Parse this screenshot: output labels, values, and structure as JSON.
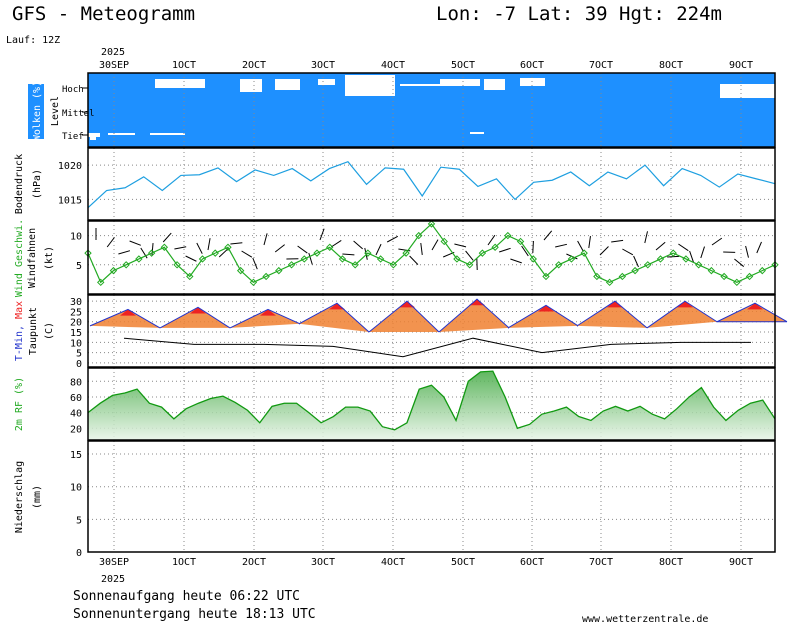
{
  "header": {
    "title": "GFS - Meteogramm",
    "location": "Lon: -7 Lat: 39 Hgt: 224m",
    "run": "Lauf: 12Z",
    "year_top": "2025",
    "year_bottom": "2025"
  },
  "footer": {
    "sunrise": "Sonnenaufgang heute 06:22 UTC",
    "sunset": "Sonnenuntergang heute 18:13 UTC",
    "source": "www.wetterzentrale.de"
  },
  "colors": {
    "cloud_blue": "#1e90ff",
    "pressure": "#1e9fe0",
    "wind": "#22aa22",
    "tmin": "#2233cc",
    "tmax": "#ee2222",
    "dewpoint": "#000000",
    "rh_fill": "#44aa44",
    "rh_line": "#119911",
    "grid": "#888888"
  },
  "chart_data": [
    {
      "type": "area",
      "panel": "clouds",
      "ylabel": "Wolken (%)",
      "ylabel2": "Level",
      "categories": [
        "30SEP",
        "1OCT",
        "2OCT",
        "3OCT",
        "4OCT",
        "5OCT",
        "6OCT",
        "7OCT",
        "8OCT",
        "9OCT"
      ],
      "levels": [
        "Hoch",
        "Mittel",
        "Tief"
      ],
      "series": [
        {
          "name": "Hoch",
          "values": [
            100,
            65,
            55,
            60,
            30,
            95,
            60,
            100,
            100,
            80
          ]
        },
        {
          "name": "Mittel",
          "values": [
            100,
            100,
            100,
            100,
            80,
            100,
            100,
            100,
            100,
            100
          ]
        },
        {
          "name": "Tief",
          "values": [
            90,
            100,
            100,
            100,
            100,
            100,
            100,
            100,
            100,
            100
          ]
        }
      ]
    },
    {
      "type": "line",
      "panel": "pressure",
      "ylabel": "Bodendruck",
      "unit": "(hPa)",
      "yticks": [
        1015,
        1020
      ],
      "ylim": [
        1012,
        1022.5
      ],
      "series": [
        {
          "values": [
            1013.8,
            1016.3,
            1016.7,
            1018.3,
            1016.3,
            1018.5,
            1018.6,
            1019.6,
            1017.6,
            1019.3,
            1018.5,
            1019.5,
            1017.7,
            1019.5,
            1020.5,
            1017.2,
            1019.6,
            1019.4,
            1015.5,
            1019.7,
            1019.4,
            1016.9,
            1018.0,
            1015.0,
            1017.5,
            1017.8,
            1019.0,
            1017.0,
            1019.0,
            1018.0,
            1020.0,
            1017.0,
            1019.5,
            1018.5,
            1016.8,
            1018.7,
            1018.0,
            1017.3
          ]
        }
      ]
    },
    {
      "type": "line",
      "panel": "wind",
      "ylabel": "Wind Geschwi.",
      "ylabel2": "Windfahnen",
      "unit": "(kt)",
      "yticks": [
        5,
        10
      ],
      "ylim": [
        0,
        12.5
      ],
      "series": [
        {
          "name": "Wind Geschwi.",
          "values": [
            7,
            2,
            4,
            5,
            6,
            7,
            8,
            5,
            3,
            6,
            7,
            8,
            4,
            2,
            3,
            4,
            5,
            6,
            7,
            8,
            6,
            5,
            7,
            6,
            5,
            7,
            10,
            12,
            9,
            6,
            5,
            7,
            8,
            10,
            9,
            6,
            3,
            5,
            6,
            7,
            3,
            2,
            3,
            4,
            5,
            6,
            7,
            6,
            5,
            4,
            3,
            2,
            3,
            4,
            5
          ]
        }
      ]
    },
    {
      "type": "area",
      "panel": "temperature",
      "ylabel": "T-Min, Max",
      "ylabel2": "Taupunkt",
      "unit": "(C)",
      "yticks": [
        0,
        5,
        10,
        15,
        20,
        25,
        30
      ],
      "ylim": [
        -2,
        33
      ],
      "categories": [
        "30SEP",
        "1OCT",
        "2OCT",
        "3OCT",
        "4OCT",
        "5OCT",
        "6OCT",
        "7OCT",
        "8OCT",
        "9OCT"
      ],
      "series": [
        {
          "name": "Max",
          "values": [
            26,
            27,
            26,
            29,
            30,
            31,
            28,
            30,
            30,
            29
          ]
        },
        {
          "name": "Min",
          "values": [
            18,
            17,
            17,
            19,
            15,
            15,
            17,
            18,
            17,
            20
          ]
        },
        {
          "name": "Taupunkt",
          "values": [
            12,
            9,
            9,
            8,
            3,
            12,
            5,
            9,
            10,
            10
          ]
        }
      ]
    },
    {
      "type": "area",
      "panel": "humidity",
      "ylabel": "2m RF",
      "unit": "(%)",
      "yticks": [
        20,
        40,
        60,
        80
      ],
      "ylim": [
        5,
        97
      ],
      "series": [
        {
          "values": [
            40,
            52,
            62,
            65,
            70,
            52,
            47,
            32,
            45,
            52,
            58,
            61,
            53,
            43,
            27,
            48,
            52,
            52,
            40,
            27,
            35,
            47,
            47,
            42,
            22,
            18,
            27,
            70,
            75,
            60,
            30,
            80,
            92,
            93,
            60,
            20,
            25,
            38,
            42,
            47,
            35,
            30,
            42,
            48,
            42,
            48,
            38,
            32,
            45,
            60,
            72,
            47,
            30,
            43,
            52,
            56,
            32
          ]
        }
      ]
    },
    {
      "type": "bar",
      "panel": "precipitation",
      "ylabel": "Niederschlag",
      "unit": "(mm)",
      "yticks": [
        0,
        5,
        10,
        15
      ],
      "ylim": [
        0,
        17
      ],
      "categories": [
        "30SEP",
        "1OCT",
        "2OCT",
        "3OCT",
        "4OCT",
        "5OCT",
        "6OCT",
        "7OCT",
        "8OCT",
        "9OCT"
      ],
      "values": [
        0,
        0,
        0,
        0,
        0,
        0,
        0,
        0,
        0,
        0
      ]
    }
  ],
  "date_labels": [
    "30SEP",
    "1OCT",
    "2OCT",
    "3OCT",
    "4OCT",
    "5OCT",
    "6OCT",
    "7OCT",
    "8OCT",
    "9OCT"
  ],
  "cloud_level_labels": [
    "Hoch",
    "Mittel",
    "Tief"
  ]
}
